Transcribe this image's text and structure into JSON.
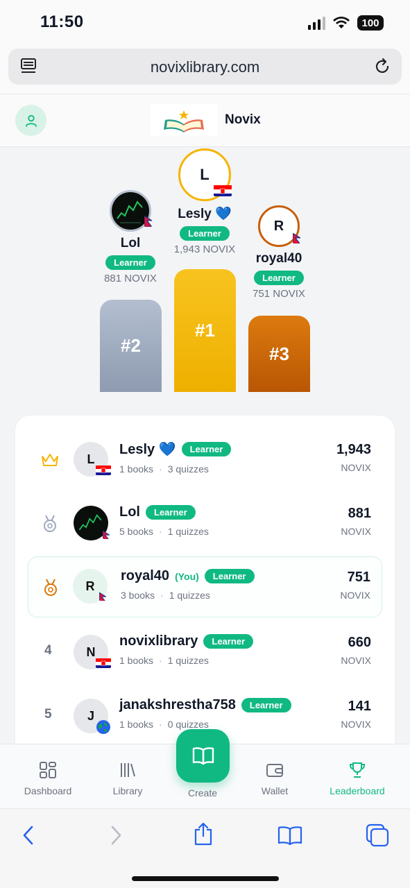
{
  "status": {
    "time": "11:50",
    "battery": "100"
  },
  "browser": {
    "url": "novixlibrary.com"
  },
  "header": {
    "brand": "Novix"
  },
  "podium": [
    {
      "rank_label": "#2",
      "name": "Lol",
      "badge": "Learner",
      "points": "881 NOVIX"
    },
    {
      "rank_label": "#1",
      "name": "Lesly 💙",
      "initial": "L",
      "badge": "Learner",
      "points": "1,943 NOVIX"
    },
    {
      "rank_label": "#3",
      "name": "royal40",
      "initial": "R",
      "badge": "Learner",
      "points": "751 NOVIX"
    }
  ],
  "leaderboard": {
    "unit": "NOVIX",
    "rows": [
      {
        "rank": "1",
        "initial": "L",
        "name": "Lesly 💙",
        "you": "",
        "badge": "Learner",
        "books": "1 books",
        "quizzes": "3 quizzes",
        "points": "1,943"
      },
      {
        "rank": "2",
        "initial": "",
        "name": "Lol",
        "you": "",
        "badge": "Learner",
        "books": "5 books",
        "quizzes": "1 quizzes",
        "points": "881"
      },
      {
        "rank": "3",
        "initial": "R",
        "name": "royal40",
        "you": "(You)",
        "badge": "Learner",
        "books": "3 books",
        "quizzes": "1 quizzes",
        "points": "751"
      },
      {
        "rank": "4",
        "initial": "N",
        "name": "novixlibrary",
        "you": "",
        "badge": "Learner",
        "books": "1 books",
        "quizzes": "1 quizzes",
        "points": "660"
      },
      {
        "rank": "5",
        "initial": "J",
        "name": "janakshrestha758",
        "you": "",
        "badge": "Learner",
        "books": "1 books",
        "quizzes": "0 quizzes",
        "points": "141"
      }
    ]
  },
  "nav": {
    "dashboard": "Dashboard",
    "library": "Library",
    "create": "Create",
    "wallet": "Wallet",
    "leaderboard": "Leaderboard"
  },
  "colors": {
    "accent": "#10b981",
    "gold": "#f5b400",
    "silver": "#9ca8bb",
    "bronze": "#c85f0a"
  }
}
